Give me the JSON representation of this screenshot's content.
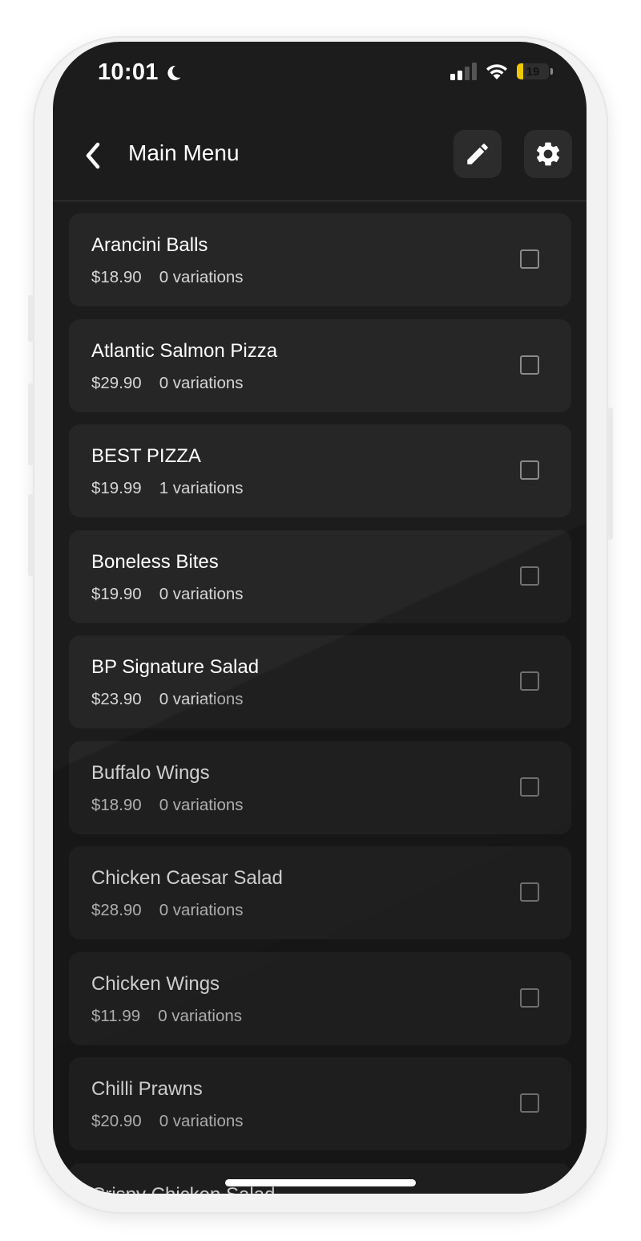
{
  "status_bar": {
    "time": "10:01",
    "battery_level": "19",
    "battery_fraction": 0.19,
    "icons": [
      "moon-icon",
      "signal-icon",
      "wifi-icon",
      "battery-icon"
    ]
  },
  "header": {
    "title": "Main Menu",
    "back_icon": "chevron-left-icon",
    "edit_icon": "pencil-icon",
    "settings_icon": "gear-icon"
  },
  "menu_items": [
    {
      "name": "Arancini Balls",
      "price": "$18.90",
      "variations": "0 variations"
    },
    {
      "name": "Atlantic Salmon Pizza",
      "price": "$29.90",
      "variations": "0 variations"
    },
    {
      "name": "BEST PIZZA",
      "price": "$19.99",
      "variations": "1 variations"
    },
    {
      "name": "Boneless Bites",
      "price": "$19.90",
      "variations": "0 variations"
    },
    {
      "name": "BP Signature Salad",
      "price": "$23.90",
      "variations": "0 variations"
    },
    {
      "name": "Buffalo Wings",
      "price": "$18.90",
      "variations": "0 variations"
    },
    {
      "name": "Chicken Caesar Salad",
      "price": "$28.90",
      "variations": "0 variations"
    },
    {
      "name": "Chicken Wings",
      "price": "$11.99",
      "variations": "0 variations"
    },
    {
      "name": "Chilli Prawns",
      "price": "$20.90",
      "variations": "0 variations"
    },
    {
      "name": "Crispy Chicken Salad",
      "price": "",
      "variations": ""
    }
  ],
  "colors": {
    "screen_bg": "#1c1c1c",
    "card_bg": "#262626",
    "text_primary": "#ffffff",
    "text_secondary": "#d6d6d6",
    "battery_accent": "#f0c800"
  }
}
